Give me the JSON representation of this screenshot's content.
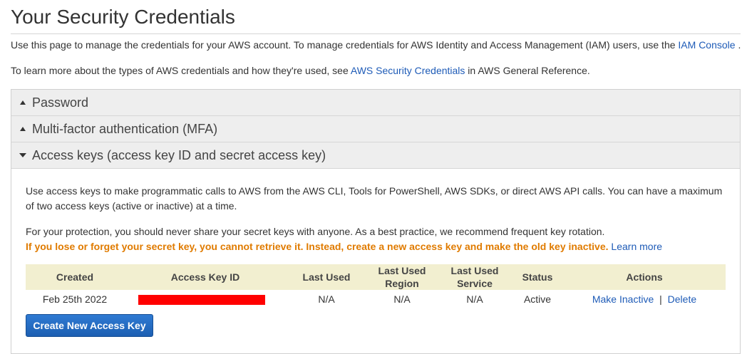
{
  "page": {
    "title": "Your Security Credentials",
    "intro1_prefix": "Use this page to manage the credentials for your AWS account. To manage credentials for AWS Identity and Access Management (IAM) users, use the ",
    "intro1_link": "IAM Console",
    "intro1_suffix": " .",
    "intro2_prefix": "To learn more about the types of AWS credentials and how they're used, see ",
    "intro2_link": "AWS Security Credentials",
    "intro2_suffix": " in AWS General Reference."
  },
  "accordion": {
    "password": "Password",
    "mfa": "Multi-factor authentication (MFA)",
    "access_keys": "Access keys (access key ID and secret access key)"
  },
  "access_keys": {
    "description": "Use access keys to make programmatic calls to AWS from the AWS CLI, Tools for PowerShell, AWS SDKs, or direct AWS API calls. You can have a maximum of two access keys (active or inactive) at a time.",
    "protection": "For your protection, you should never share your secret keys with anyone. As a best practice, we recommend frequent key rotation.",
    "warning": "If you lose or forget your secret key, you cannot retrieve it. Instead, create a new access key and make the old key inactive.",
    "learn_more": "Learn more",
    "columns": {
      "created": "Created",
      "access_key_id": "Access Key ID",
      "last_used": "Last Used",
      "last_used_region_1": "Last Used",
      "last_used_region_2": "Region",
      "last_used_service_1": "Last Used",
      "last_used_service_2": "Service",
      "status": "Status",
      "actions": "Actions"
    },
    "rows": [
      {
        "created": "Feb 25th 2022",
        "last_used": "N/A",
        "last_used_region": "N/A",
        "last_used_service": "N/A",
        "status": "Active",
        "action_inactive": "Make Inactive",
        "action_separator": "|",
        "action_delete": "Delete"
      }
    ],
    "create_button": "Create New Access Key"
  },
  "colors": {
    "link": "#1e5bb7",
    "warning": "#e07b00",
    "table_header_bg": "#f2efd0",
    "button": "#1c5fb2",
    "redaction": "#ff0000"
  }
}
